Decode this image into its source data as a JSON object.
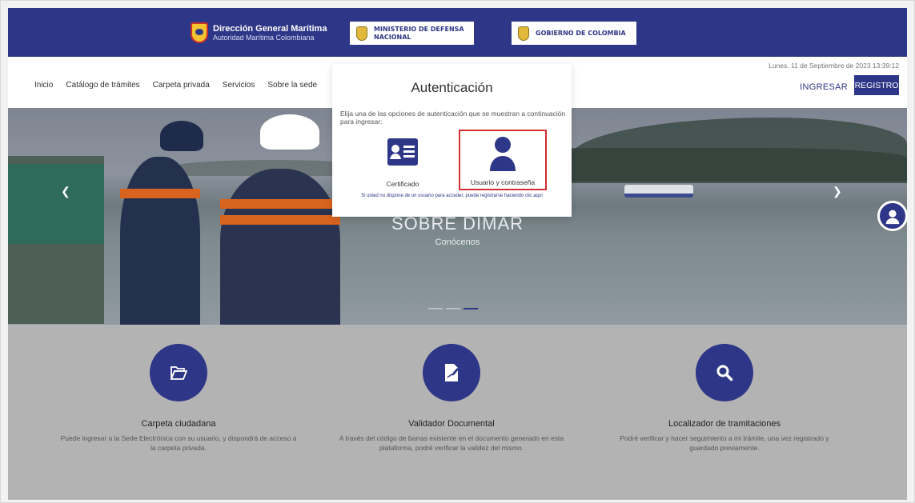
{
  "header": {
    "brand_title": "Dirección General Marítima",
    "brand_subtitle": "Autoridad Marítima Colombiana",
    "ministry_line1": "MINISTERIO DE DEFENSA",
    "ministry_line2": "NACIONAL",
    "government": "GOBIERNO DE COLOMBIA"
  },
  "nav": {
    "items": [
      "Inicio",
      "Catálogo de trámites",
      "Carpeta privada",
      "Servicios",
      "Sobre la sede"
    ],
    "datetime": "Lunes, 11 de Septiembre de 2023 13:39:12",
    "login_label": "INGRESAR",
    "register_label": "REGISTRO"
  },
  "hero": {
    "title": "SOBRE DIMAR",
    "subtitle": "Conócenos",
    "prev_icon": "chevron-left-icon",
    "next_icon": "chevron-right-icon",
    "slide_count": 3,
    "active_slide": 3
  },
  "modal": {
    "title": "Autenticación",
    "description": "Elija una de las opciones de autenticación que se muestran a continuación para ingresar:",
    "options": [
      {
        "label": "Certificado",
        "icon": "id-card-icon",
        "selected": false
      },
      {
        "label": "Usuario y contraseña",
        "icon": "user-icon",
        "selected": true
      }
    ],
    "footer_link": "Si usted no dispone de un usuario para acceder, puede registrarse haciendo clic aquí"
  },
  "features": [
    {
      "title": "Carpeta ciudadana",
      "description": "Puede ingresar a la Sede Electrónica con su usuario, y dispondrá de acceso a la carpeta privada.",
      "icon": "folder-open-icon"
    },
    {
      "title": "Validador Documental",
      "description": "A través del código de barras existente en el documento generado en esta plataforma, podré verificar la validez del mismo.",
      "icon": "document-signature-icon"
    },
    {
      "title": "Localizador de tramitaciones",
      "description": "Podré verificar y hacer seguimiento a mi trámite, una vez registrado y guardado previamente.",
      "icon": "search-icon"
    }
  ],
  "colors": {
    "primary": "#2e3687",
    "highlight": "#d32f2f",
    "overlay": "#b3b3b3"
  }
}
